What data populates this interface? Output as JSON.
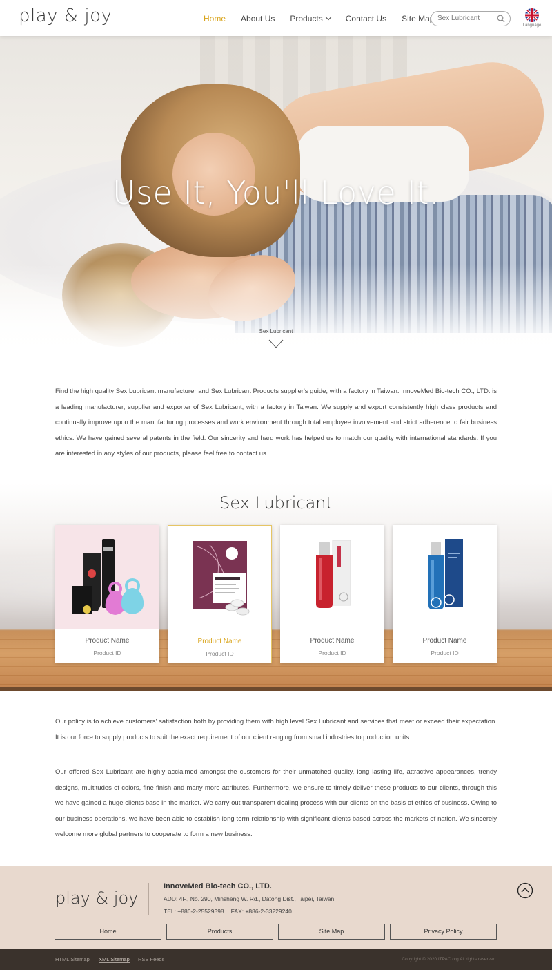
{
  "header": {
    "logo": "play & joy",
    "nav": [
      {
        "label": "Home",
        "active": true
      },
      {
        "label": "About Us"
      },
      {
        "label": "Products",
        "has_dropdown": true
      },
      {
        "label": "Contact Us"
      },
      {
        "label": "Site Map"
      }
    ],
    "search_placeholder": "Sex Lubricant",
    "language_label": "Language",
    "accent_color": "#d9a41b"
  },
  "hero": {
    "slogan": "Use It, You'll Love It.",
    "scroll_label": "Sex Lubricant"
  },
  "intro": "Find the high quality Sex Lubricant manufacturer and Sex Lubricant Products supplier's guide, with a factory in Taiwan. InnoveMed Bio-tech CO., LTD. is a leading manufacturer, supplier and exporter of Sex Lubricant, with a factory in Taiwan. We supply and export consistently high class products and continually improve upon the manufacturing processes and work environment through total employee involvement and strict adherence to fair business ethics. We have gained several patents in the field. Our sincerity and hard work has helped us to match our quality with international standards. If you are interested in any styles of our products, please feel free to contact us.",
  "products": {
    "title": "Sex Lubricant",
    "items": [
      {
        "name": "Product Name",
        "id": "Product ID"
      },
      {
        "name": "Product Name",
        "id": "Product ID"
      },
      {
        "name": "Product Name",
        "id": "Product ID"
      },
      {
        "name": "Product Name",
        "id": "Product ID"
      }
    ]
  },
  "policy": "Our policy is to achieve customers' satisfaction both by providing them with high level Sex Lubricant and services that meet or exceed their expectation. It is our force to supply products to suit the exact requirement of our client ranging from small industries to production units.",
  "offered": "Our offered Sex Lubricant are highly acclaimed amongst the customers for their unmatched quality, long lasting life, attractive appearances, trendy designs, multitudes of colors, fine finish and many more attributes. Furthermore, we ensure to timely deliver these products to our clients, through this we have gained a huge clients base in the market. We carry out transparent dealing process with our clients on the basis of ethics of business. Owing to our business operations, we have been able to establish long term relationship with significant clients based across the markets of nation. We sincerely welcome more global partners to cooperate to form a new business.",
  "footer": {
    "logo": "play & joy",
    "company": "InnoveMed Bio-tech CO., LTD.",
    "address": "ADD: 4F., No. 290, Minsheng W. Rd., Datong Dist., Taipei, Taiwan",
    "tel": "TEL: +886-2-25529398",
    "fax": "FAX: +886-2-33229240",
    "buttons": [
      "Home",
      "Products",
      "Site Map",
      "Privacy Policy"
    ],
    "bottom_links": [
      "HTML Sitemap",
      "XML Sitemap",
      "RSS Feeds"
    ],
    "copyright": "Copyright © 2020 ITPAC.org All rights reserved."
  }
}
